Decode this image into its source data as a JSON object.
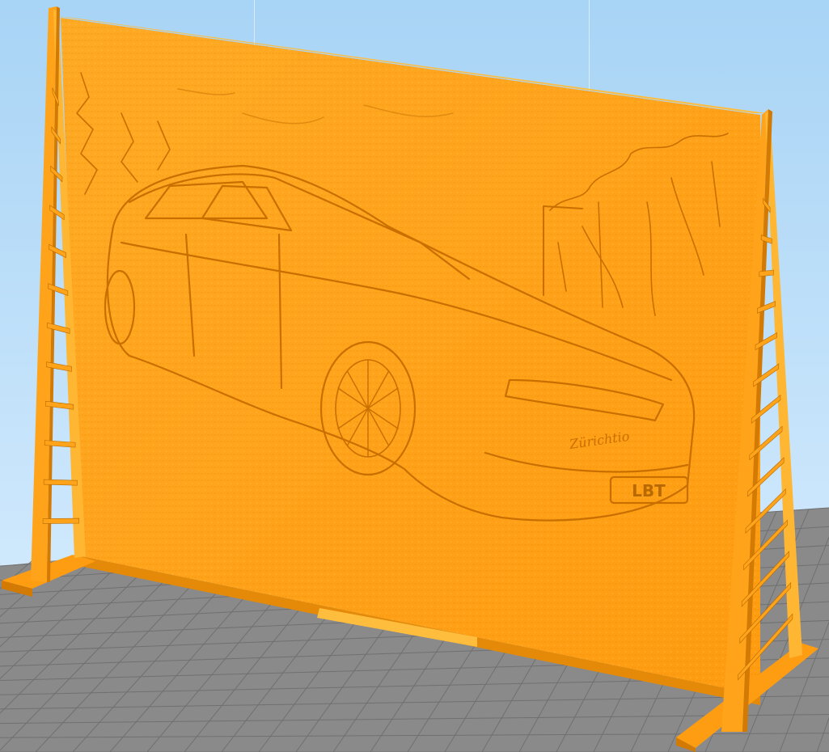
{
  "viewport": {
    "label": "",
    "colors": {
      "sky_top": "#a8d4f5",
      "sky_bottom": "#dcefff",
      "bed_base": "#8a8a8a",
      "bed_grid": "#707070",
      "model_main": "#ffa31a",
      "model_light": "#ffbd3d",
      "model_dark": "#d97e05",
      "model_shadow": "#b86a00"
    }
  },
  "model": {
    "kind": "lithophane-panel-with-stands",
    "relief_subject": "station-wagon-car-in-forest",
    "relief_text": [
      "Zürichtio",
      "LBT"
    ]
  }
}
